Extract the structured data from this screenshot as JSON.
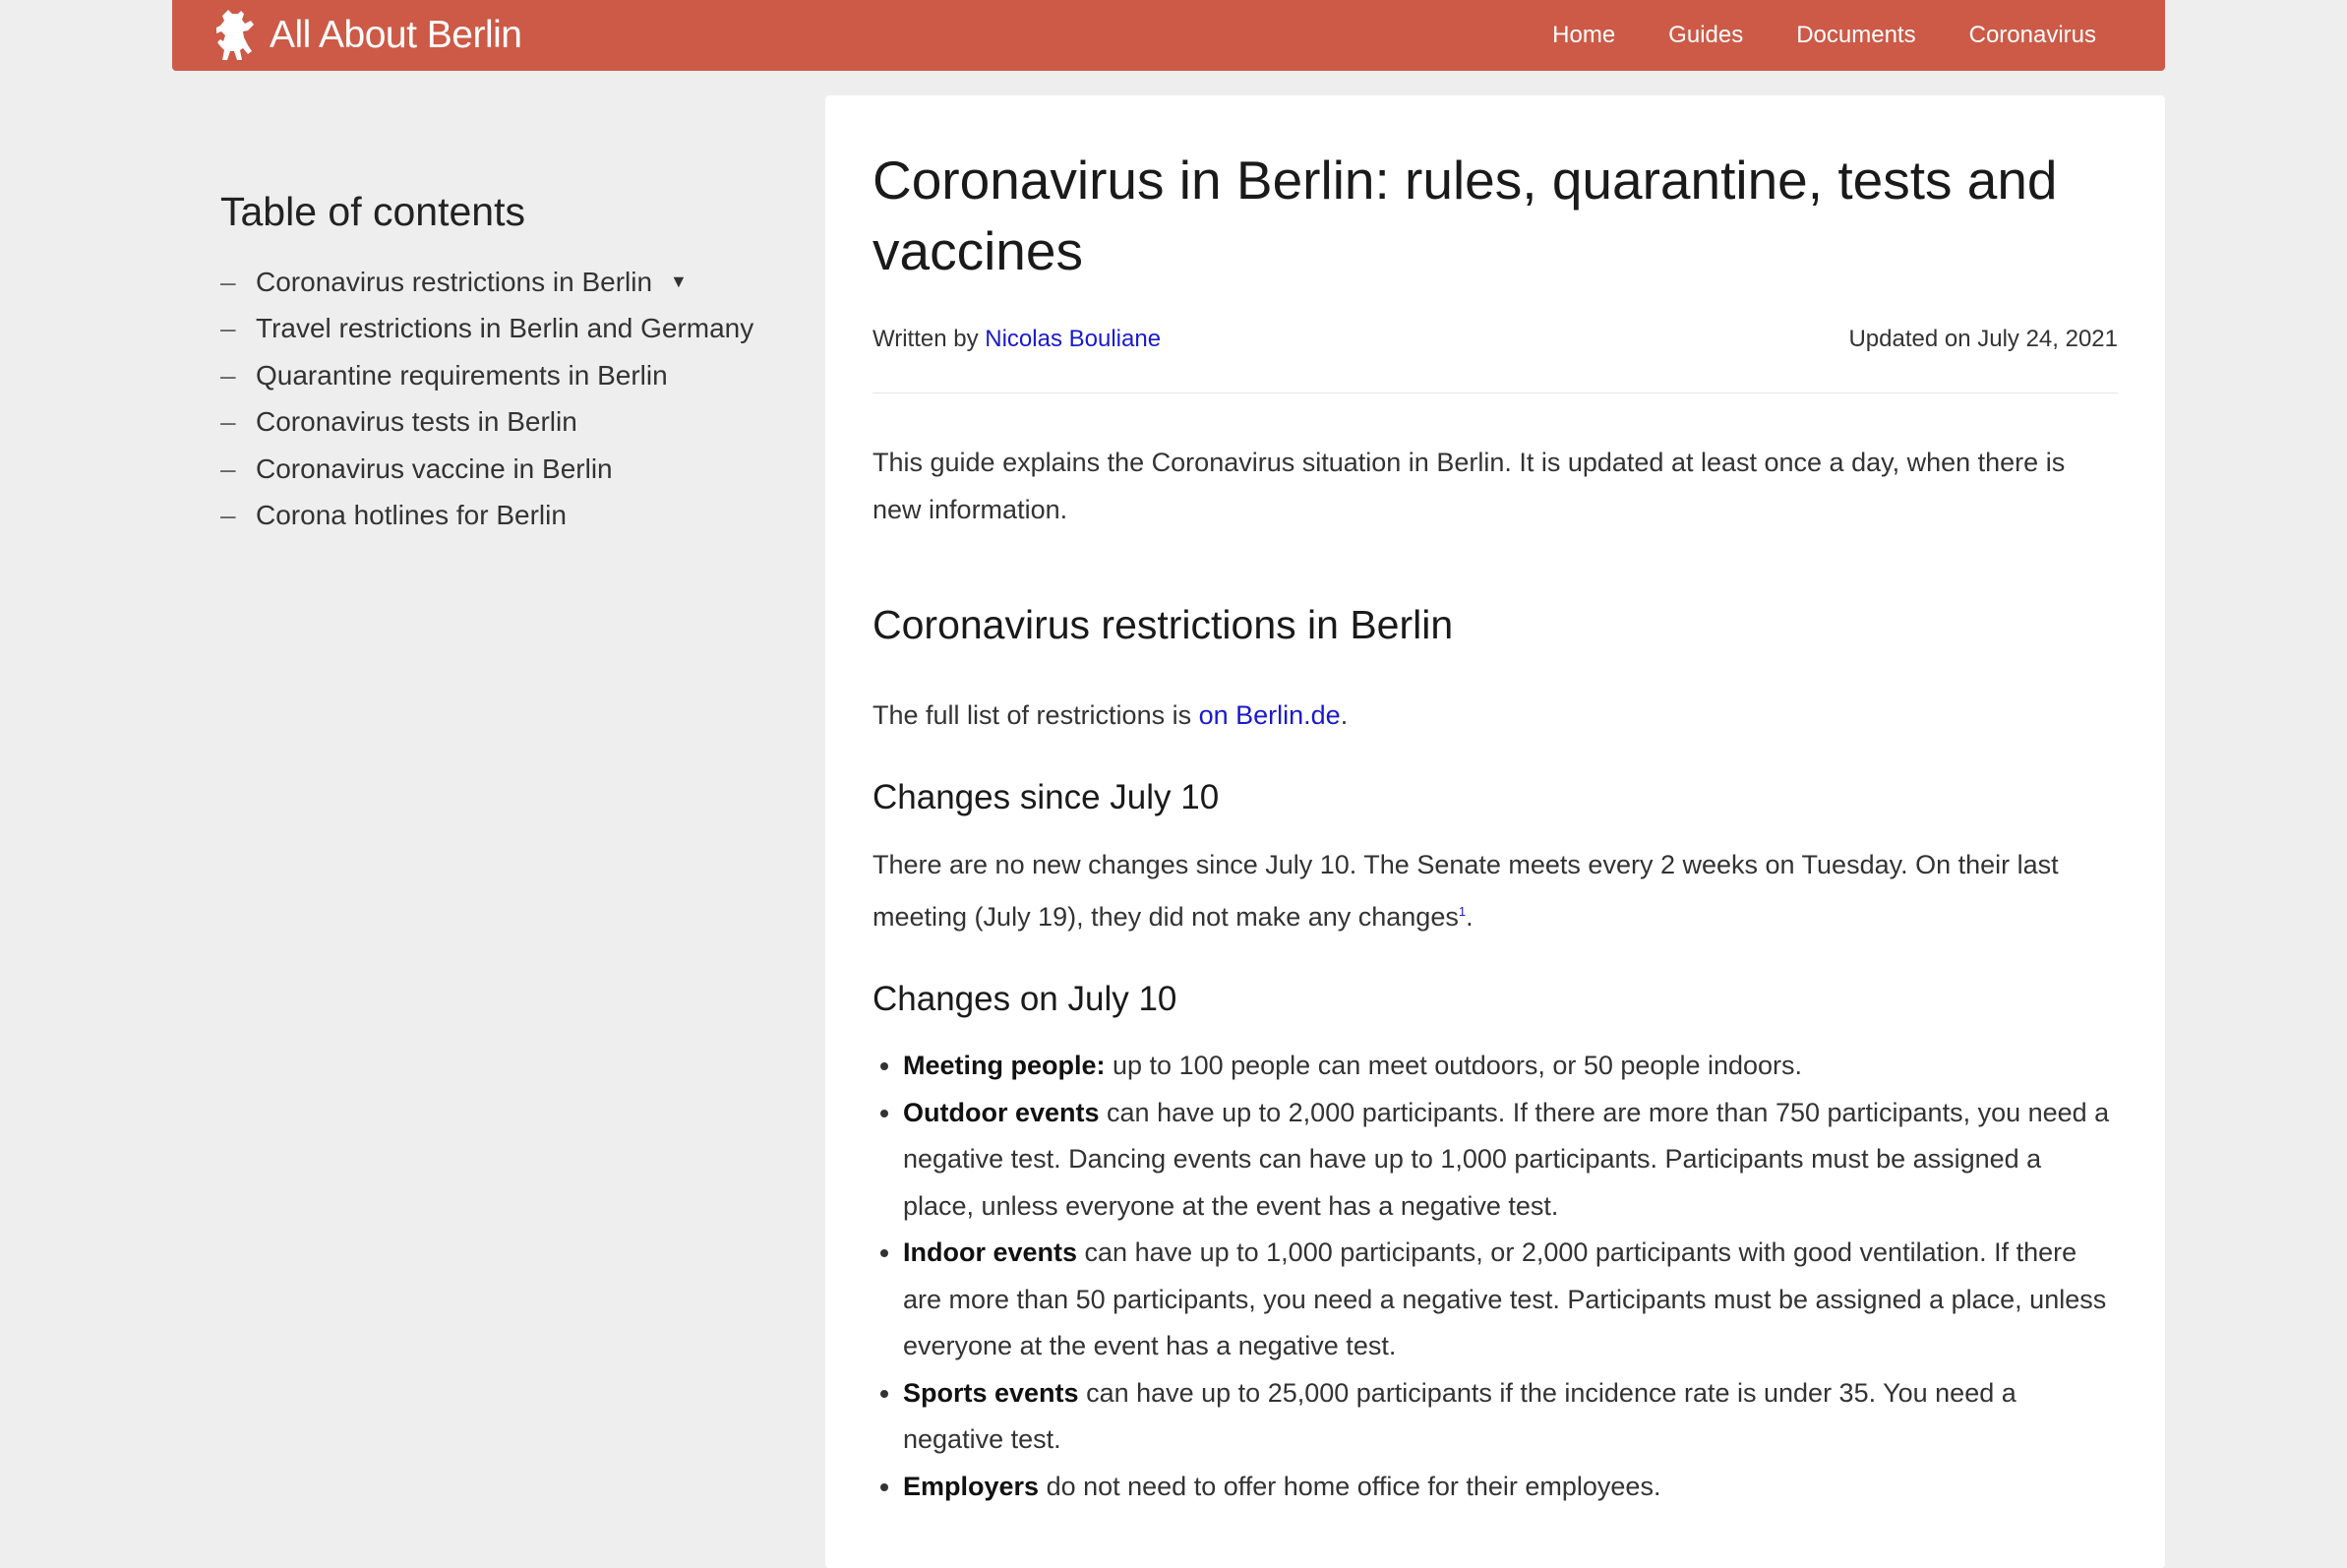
{
  "header": {
    "brand": "All About Berlin",
    "nav": [
      "Home",
      "Guides",
      "Documents",
      "Coronavirus"
    ]
  },
  "toc": {
    "title": "Table of contents",
    "items": [
      "Coronavirus restrictions in Berlin",
      "Travel restrictions in Berlin and Germany",
      "Quarantine requirements in Berlin",
      "Coronavirus tests in Berlin",
      "Coronavirus vaccine in Berlin",
      "Corona hotlines for Berlin"
    ],
    "dash": "–",
    "arrow": "▼"
  },
  "article": {
    "title": "Coronavirus in Berlin: rules, quarantine, tests and vaccines",
    "written_by": "Written by",
    "author": "Nicolas Bouliane",
    "updated": "Updated on July 24, 2021",
    "intro": "This guide explains the Coronavirus situation in Berlin. It is updated at least once a day, when there is new information.",
    "section1": {
      "heading": "Coronavirus restrictions in Berlin",
      "full_list_prefix": "The full list of restrictions is ",
      "full_list_link": "on Berlin.de",
      "full_list_suffix": "."
    },
    "changes_since": {
      "heading": "Changes since July 10",
      "text": "There are no new changes since July 10. The Senate meets every 2 weeks on Tuesday. On their last meeting (July 19), they did not make any changes",
      "footnote": "1",
      "end": "."
    },
    "changes_on": {
      "heading": "Changes on July 10",
      "bullets": [
        {
          "bold": "Meeting people:",
          "text": " up to 100 people can meet outdoors, or 50 people indoors."
        },
        {
          "bold": "Outdoor events",
          "text": " can have up to 2,000 participants. If there are more than 750 participants, you need a negative test. Dancing events can have up to 1,000 participants. Participants must be assigned a place, unless everyone at the event has a negative test."
        },
        {
          "bold": "Indoor events",
          "text": " can have up to 1,000 participants, or 2,000 participants with good ventilation. If there are more than 50 participants, you need a negative test. Participants must be assigned a place, unless everyone at the event has a negative test."
        },
        {
          "bold": "Sports events",
          "text": " can have up to 25,000 participants if the incidence rate is under 35. You need a negative test."
        },
        {
          "bold": "Employers",
          "text": " do not need to offer home office for their employees."
        }
      ]
    }
  },
  "colors": {
    "header_bg": "#cc5a47",
    "link": "#1a1acc",
    "page_bg": "#eeeeee"
  },
  "icons": {
    "brand": "berlin-bear-icon"
  }
}
